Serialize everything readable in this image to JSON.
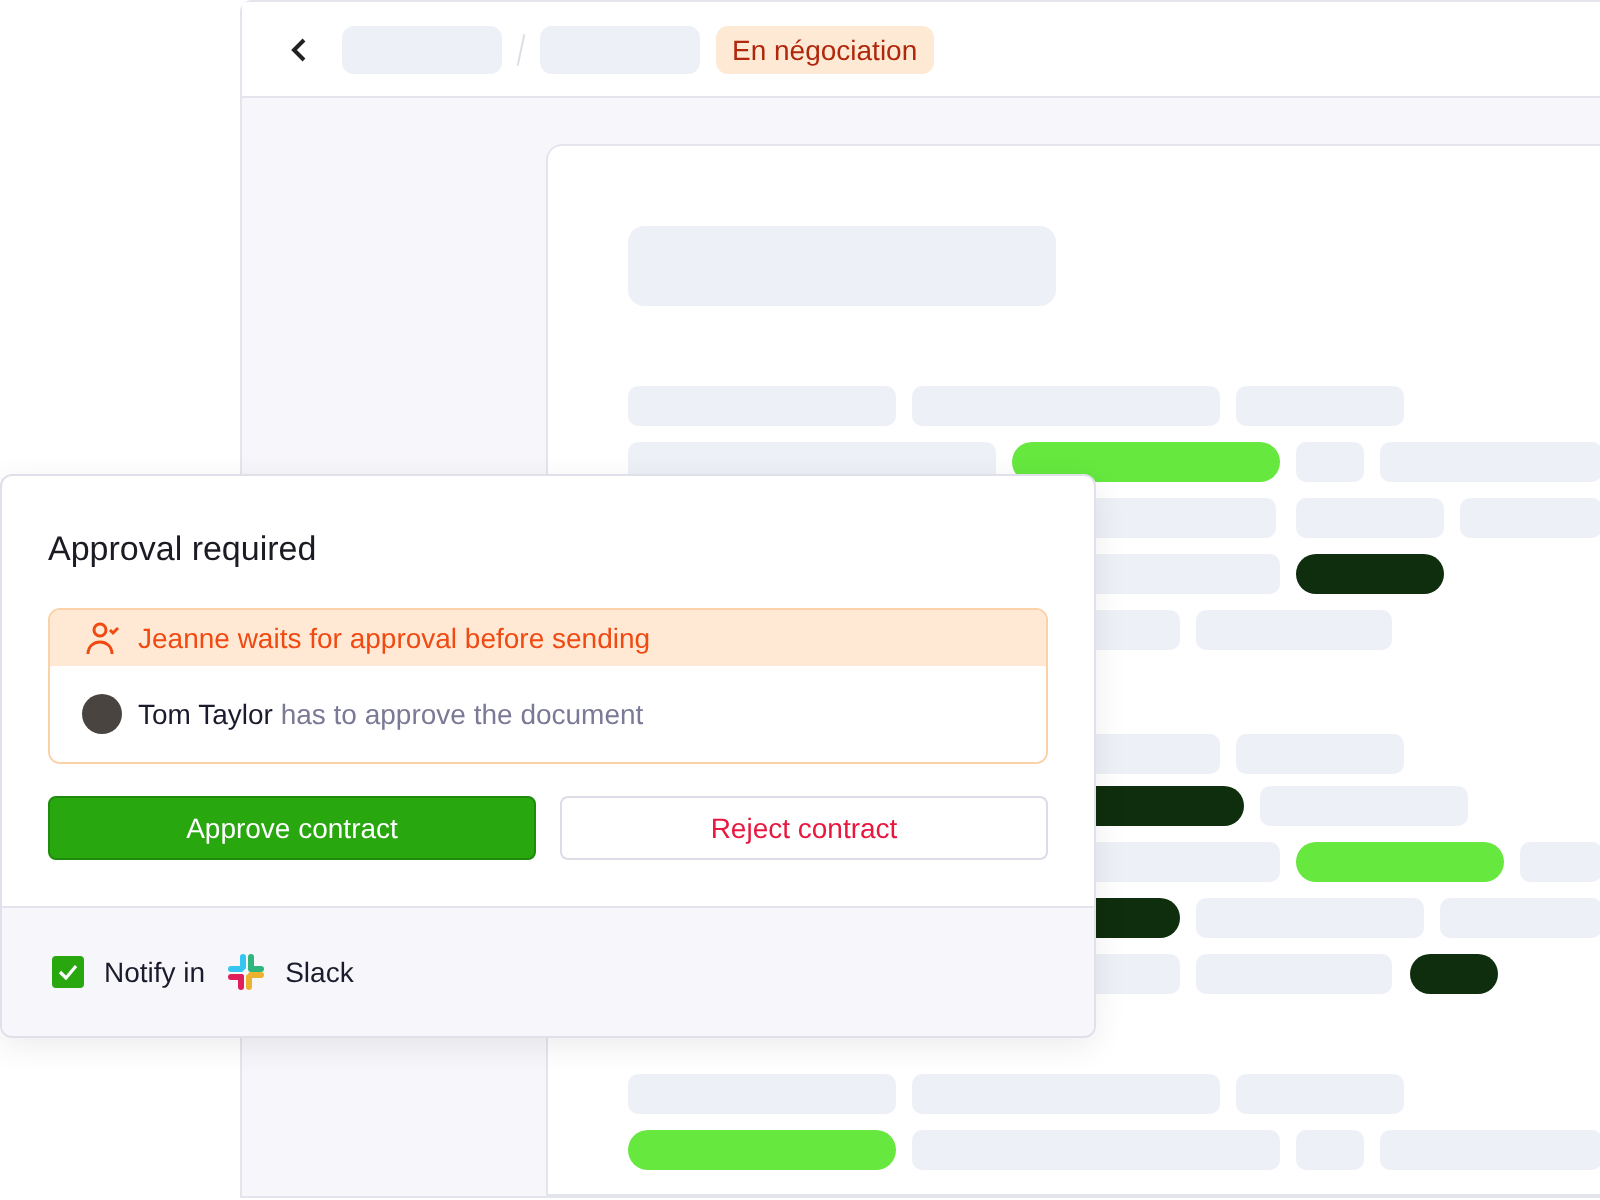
{
  "header": {
    "status_badge": "En négociation"
  },
  "approval": {
    "title": "Approval required",
    "alert": "Jeanne waits for approval before sending",
    "approver": {
      "name": "Tom Taylor",
      "text": "has to approve the document"
    },
    "buttons": [
      {
        "kind": "primary",
        "label": "Approve contract"
      },
      {
        "kind": "danger",
        "label": "Reject contract"
      }
    ],
    "notify": {
      "checked": true,
      "label": "Notify in",
      "app": "Slack"
    }
  }
}
